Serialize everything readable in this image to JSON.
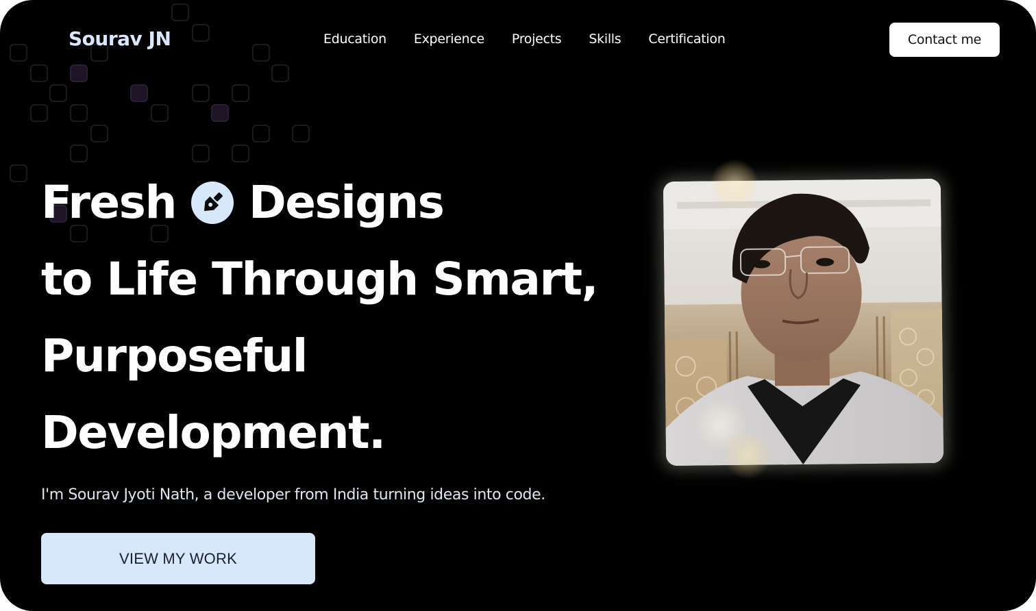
{
  "brand": {
    "name": "Sourav JN"
  },
  "nav": {
    "items": [
      {
        "label": "Education"
      },
      {
        "label": "Experience"
      },
      {
        "label": "Projects"
      },
      {
        "label": "Skills"
      },
      {
        "label": "Certification"
      }
    ]
  },
  "header": {
    "contact_label": "Contact me"
  },
  "hero": {
    "headline_line1_start": "Fresh",
    "headline_line1_end": "Designs",
    "headline_line2": "to Life Through Smart,",
    "headline_line3": "Purposeful",
    "headline_line4": "Development.",
    "tagline": "I'm Sourav Jyoti Nath, a developer from India turning ideas into code.",
    "cta_label": "VIEW MY WORK",
    "inline_icon": "pen-nib-icon"
  },
  "profile": {
    "image": "profile-photo"
  },
  "colors": {
    "background": "#000000",
    "accent": "#d7e8fb",
    "brand_text": "#d9e8ff",
    "text": "#ffffff"
  }
}
